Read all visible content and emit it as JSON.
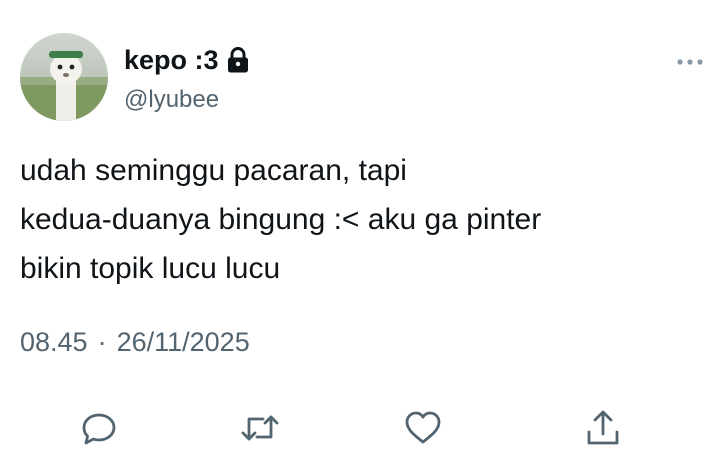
{
  "user": {
    "display_name": "kepo :3",
    "handle": "@lyubee",
    "avatar_icon": "profile-photo",
    "locked_icon": "lock-icon"
  },
  "tweet": {
    "lines": [
      "udah seminggu pacaran, tapi",
      "kedua-duanya bingung :< aku ga pinter",
      "bikin topik lucu lucu"
    ],
    "time": "08.45",
    "separator": "·",
    "date": "26/11/2025"
  },
  "actions": {
    "reply_icon": "reply-icon",
    "retweet_icon": "retweet-icon",
    "like_icon": "heart-icon",
    "share_icon": "share-icon"
  },
  "colors": {
    "text": "#0f1419",
    "secondary": "#536471",
    "icon": "#536471"
  }
}
